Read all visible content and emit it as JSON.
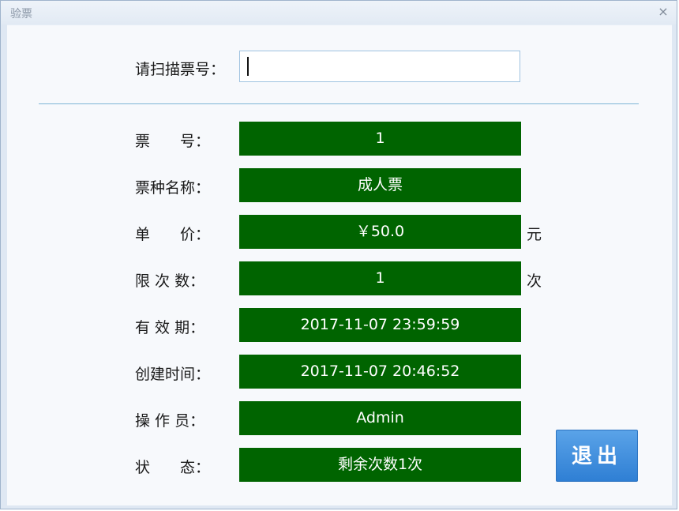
{
  "window": {
    "title": "验票",
    "close_glyph": "×"
  },
  "scan": {
    "label": "请扫描票号：",
    "value": ""
  },
  "fields": [
    {
      "label": "票　　号：",
      "value": "1",
      "unit": ""
    },
    {
      "label": "票种名称：",
      "value": "成人票",
      "unit": ""
    },
    {
      "label": "单　　价：",
      "value": "￥50.0",
      "unit": "元"
    },
    {
      "label": "限 次 数：",
      "value": "1",
      "unit": "次"
    },
    {
      "label": "有 效 期：",
      "value": "2017-11-07 23:59:59",
      "unit": ""
    },
    {
      "label": "创建时间：",
      "value": "2017-11-07 20:46:52",
      "unit": ""
    },
    {
      "label": "操 作 员：",
      "value": "Admin",
      "unit": ""
    },
    {
      "label": "状　　态：",
      "value": "剩余次数1次",
      "unit": ""
    }
  ],
  "actions": {
    "exit_label": "退出"
  },
  "colors": {
    "value_bg": "#006400",
    "button_bg": "#3a8ee0",
    "divider": "#7fb6d6"
  }
}
